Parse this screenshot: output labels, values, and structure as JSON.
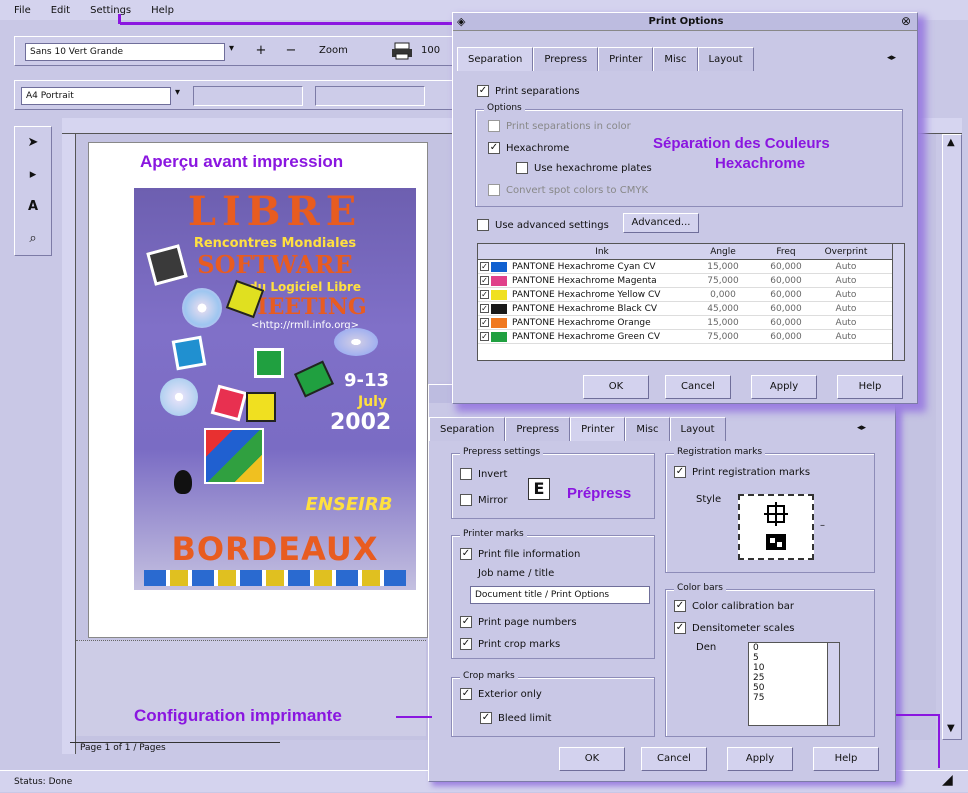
{
  "menubar": [
    "File",
    "Edit",
    "Settings",
    "Help"
  ],
  "toolbar1": {
    "document_select": "Sans 10 Vert Grande",
    "plus": "+",
    "minus": "−",
    "zoom_label": "Zoom",
    "printer_icon": "printer-icon",
    "right_field": "100"
  },
  "toolbar2": {
    "style_select": "A4 Portrait"
  },
  "tools": [
    "arrow-icon",
    "select-icon",
    "text-icon",
    "zoom-icon"
  ],
  "preview": {
    "callout": "Aperçu avant impression",
    "poster": {
      "title": "LIBRE",
      "line1": "Rencontres Mondiales",
      "line2": "SOFTWARE",
      "line3": "du Logiciel Libre",
      "line4": "MEETING",
      "url": "<http://rmll.info.org>",
      "date_days": "9-13",
      "date_month": "July",
      "date_year": "2002",
      "org": "ENSEIRB",
      "city": "BORDEAUX"
    }
  },
  "statusbar": {
    "text": "Status: Done"
  },
  "bottom_tabs": {
    "text": "Page 1 of 1 / Pages"
  },
  "print_options": {
    "title": "Print Options",
    "tabs": [
      "Separation",
      "Prepress",
      "Printer",
      "Misc",
      "Layout"
    ],
    "print_separations": "Print separations",
    "options_legend": "Options",
    "opt1": "Print separations in color",
    "opt2": "Hexachrome",
    "opt3": "Use hexachrome plates",
    "opt4": "Convert spot colors to CMYK",
    "callout_l1": "Séparation des Couleurs",
    "callout_l2": "Hexachrome",
    "advanced_label": "Use advanced settings",
    "advanced_btn": "Advanced...",
    "table_headers": [
      "",
      "Ink",
      "Angle",
      "Freq",
      "Overprint",
      ""
    ],
    "table_rows": [
      {
        "color": "#1060d0",
        "ink": "PANTONE Hexachrome Cyan CV",
        "angle": "15,000",
        "freq": "60,000",
        "ov": "Auto"
      },
      {
        "color": "#e0408a",
        "ink": "PANTONE Hexachrome Magenta",
        "angle": "75,000",
        "freq": "60,000",
        "ov": "Auto"
      },
      {
        "color": "#f0e020",
        "ink": "PANTONE Hexachrome Yellow CV",
        "angle": "0,000",
        "freq": "60,000",
        "ov": "Auto"
      },
      {
        "color": "#1a1a1a",
        "ink": "PANTONE Hexachrome Black CV",
        "angle": "45,000",
        "freq": "60,000",
        "ov": "Auto"
      },
      {
        "color": "#f07820",
        "ink": "PANTONE Hexachrome Orange",
        "angle": "15,000",
        "freq": "60,000",
        "ov": "Auto"
      },
      {
        "color": "#20a040",
        "ink": "PANTONE Hexachrome Green CV",
        "angle": "75,000",
        "freq": "60,000",
        "ov": "Auto"
      }
    ],
    "buttons": [
      "OK",
      "Cancel",
      "Apply",
      "Help"
    ]
  },
  "printer_dialog": {
    "tabs": [
      "Separation",
      "Prepress",
      "Printer",
      "Misc",
      "Layout"
    ],
    "prepress_legend": "Prepress settings",
    "pp_opt1": "Invert",
    "pp_opt2": "Mirror",
    "prepress_callout": "Prépress",
    "marks_legend": "Printer marks",
    "marks_opt1": "Print file information",
    "marks_field_label": "Job name / title",
    "marks_field": "Document title / Print Options",
    "marks_opt2": "Print page numbers",
    "marks_opt3": "Print crop marks",
    "right_legend1": "Registration marks",
    "right_opt1": "Print registration marks",
    "style_label": "Style",
    "right_legend2": "Color bars",
    "right_opt2": "Color calibration bar",
    "right_opt3": "Densitometer scales",
    "dens_label": "Den",
    "dens_list": [
      "0",
      "5",
      "10",
      "25",
      "50",
      "75"
    ],
    "bottom_legend": "Crop marks",
    "bottom_opt1": "Exterior only",
    "bottom_opt2": "Bleed limit",
    "callout": "Configuration imprimante",
    "buttons": [
      "OK",
      "Cancel",
      "Apply",
      "Help"
    ]
  },
  "colors": {
    "accent": "#8a16e0",
    "bg": "#c9c8e6",
    "dialog_shadow": "#9b7fe0"
  }
}
